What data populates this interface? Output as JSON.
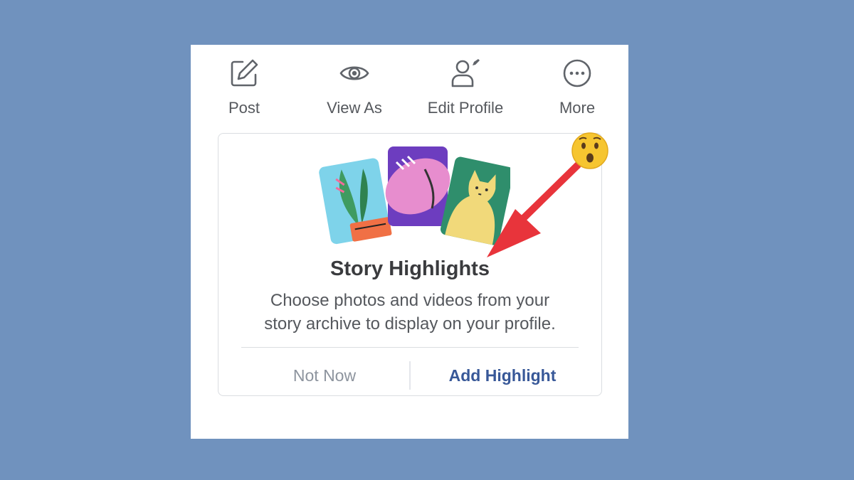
{
  "actions": [
    {
      "label": "Post",
      "icon": "pencil-square-icon"
    },
    {
      "label": "View As",
      "icon": "eye-icon"
    },
    {
      "label": "Edit Profile",
      "icon": "person-edit-icon"
    },
    {
      "label": "More",
      "icon": "more-dots-icon"
    }
  ],
  "card": {
    "title": "Story Highlights",
    "description_line1": "Choose photos and videos from your",
    "description_line2": "story archive to display on your profile.",
    "not_now_label": "Not Now",
    "add_highlight_label": "Add Highlight"
  },
  "annotation": {
    "arrow_color": "#e8343b",
    "emoji": "surprised-face-emoji"
  },
  "colors": {
    "background": "#7092be",
    "link": "#385898"
  }
}
